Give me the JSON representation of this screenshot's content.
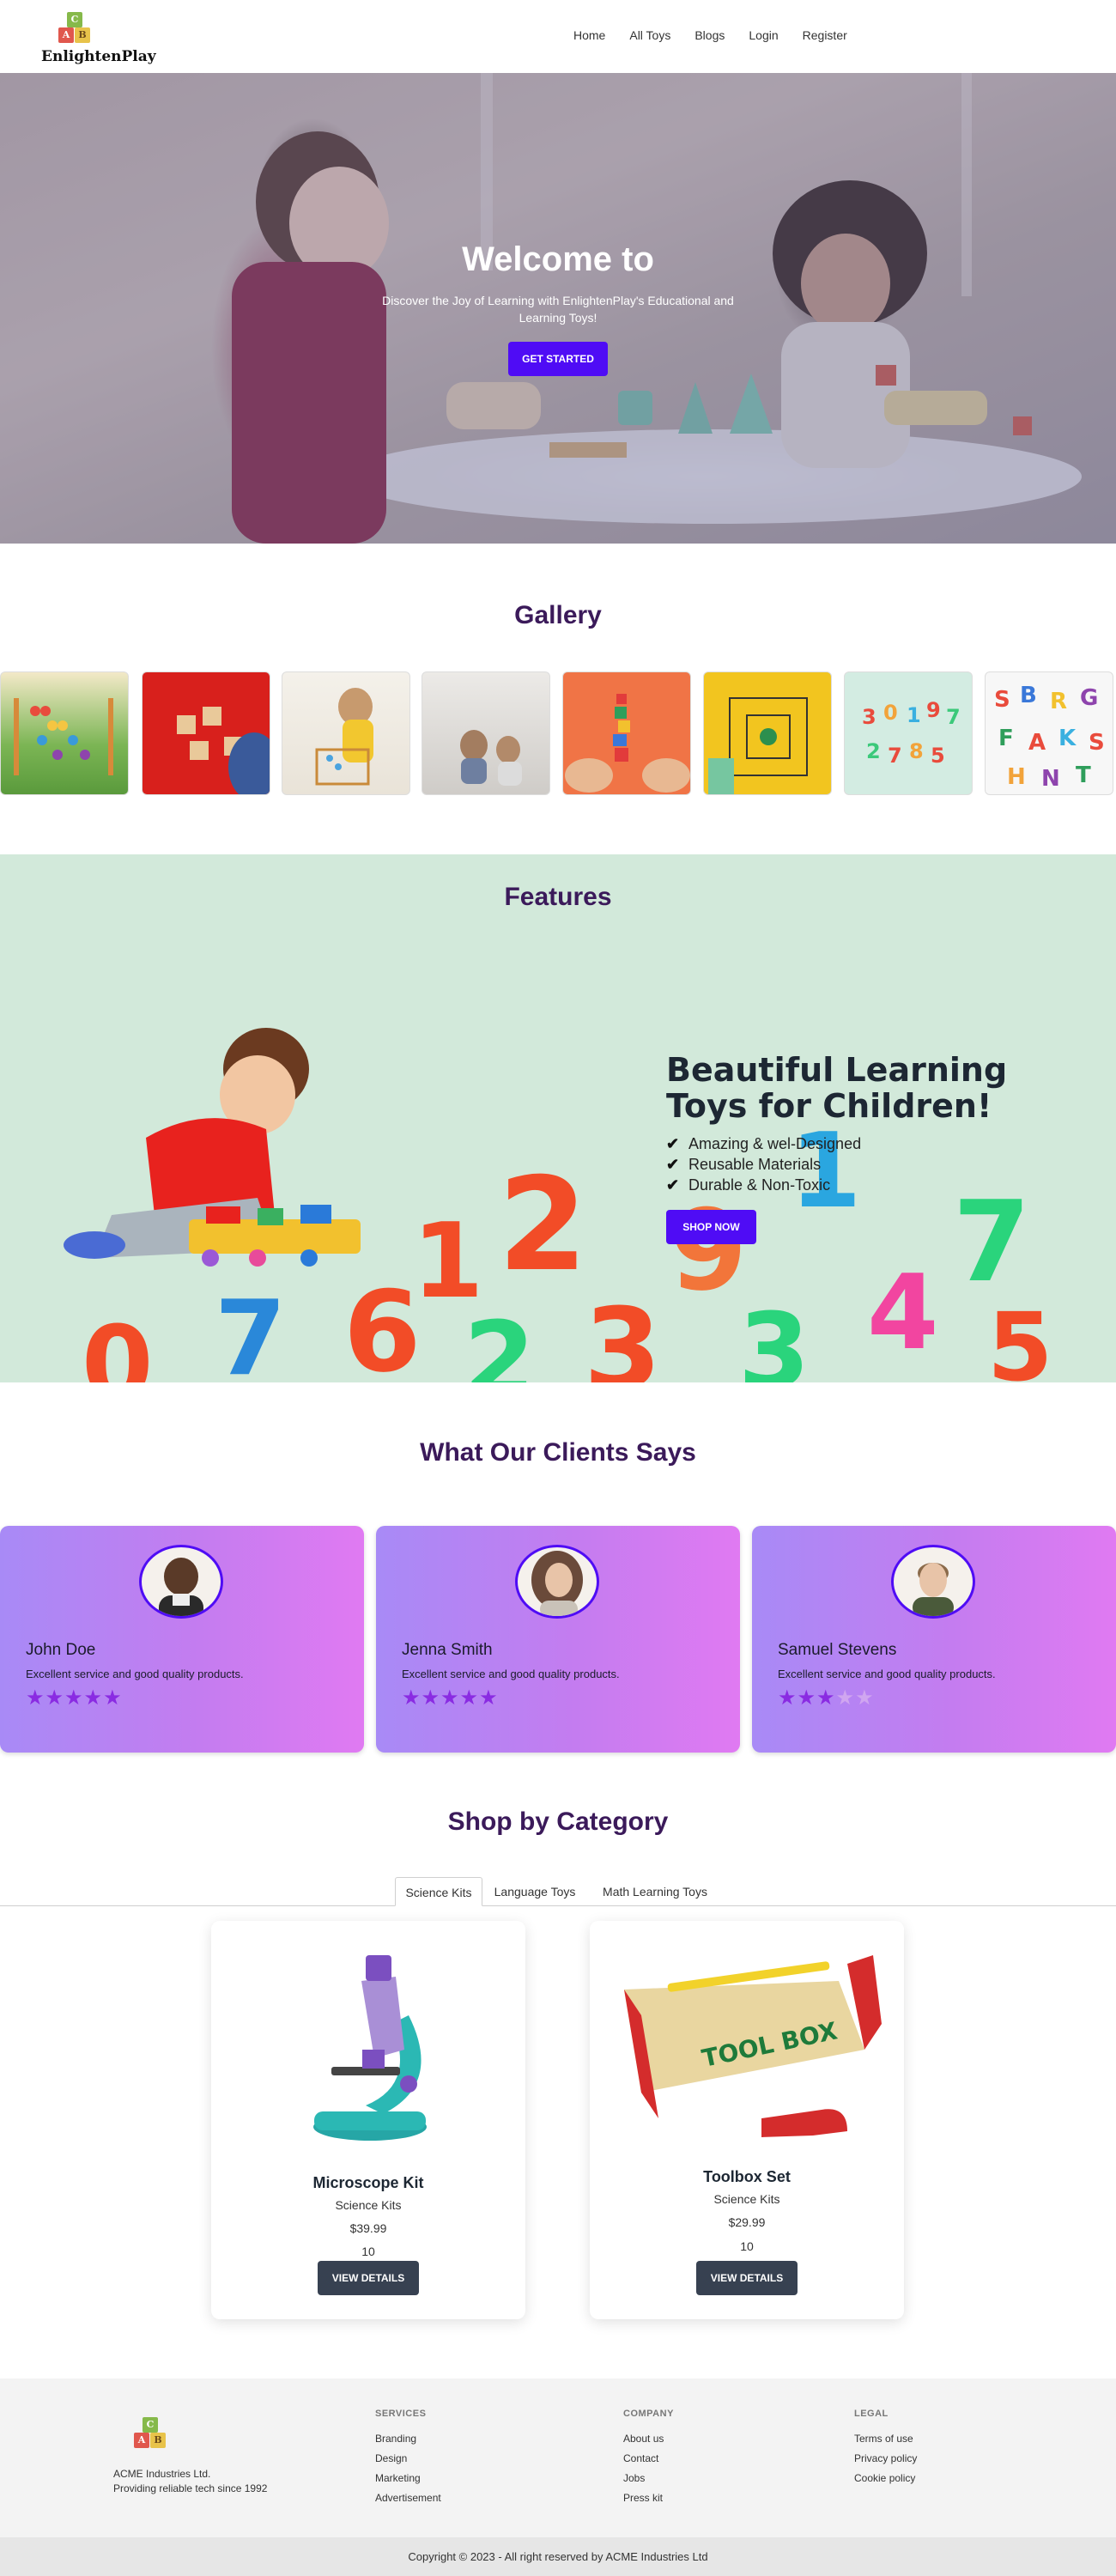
{
  "brand": {
    "name": "EnlightenPlay",
    "logo_letters": [
      "C",
      "A",
      "B"
    ]
  },
  "nav": {
    "items": [
      "Home",
      "All Toys",
      "Blogs",
      "Login",
      "Register"
    ]
  },
  "hero": {
    "title": "Welcome to",
    "subtitle": "Discover the Joy of Learning with EnlightenPlay's Educational and Learning Toys!",
    "button": "GET STARTED"
  },
  "gallery": {
    "title": "Gallery"
  },
  "features": {
    "title": "Features",
    "heading": "Beautiful Learning Toys for Children!",
    "items": [
      "Amazing & wel-Designed",
      "Reusable Materials",
      "Durable & Non-Toxic"
    ],
    "button": "SHOP NOW",
    "numbers": [
      "1",
      "2",
      "9",
      "1",
      "7",
      "6",
      "3",
      "4",
      "7",
      "3",
      "5",
      "0",
      "2"
    ]
  },
  "testimonials": {
    "title": "What Our Clients Says",
    "items": [
      {
        "name": "John Doe",
        "text": "Excellent service and good quality products.",
        "rating": 5
      },
      {
        "name": "Jenna Smith",
        "text": "Excellent service and good quality products.",
        "rating": 5
      },
      {
        "name": "Samuel Stevens",
        "text": "Excellent service and good quality products.",
        "rating": 3
      }
    ],
    "star_on": "★",
    "star_off": "★"
  },
  "shop": {
    "title": "Shop by Category",
    "tabs": [
      "Science Kits",
      "Language Toys",
      "Math Learning Toys"
    ],
    "active_tab": "Science Kits",
    "products": [
      {
        "name": "Microscope Kit",
        "category": "Science Kits",
        "price": "$39.99",
        "quantity": "10",
        "button": "VIEW DETAILS"
      },
      {
        "name": "Toolbox Set",
        "category": "Science Kits",
        "price": "$29.99",
        "quantity": "10",
        "button": "VIEW DETAILS",
        "image_label": "TOOL BOX"
      }
    ]
  },
  "footer": {
    "company_name": "ACME Industries Ltd.",
    "tagline": "Providing reliable tech since 1992",
    "columns": [
      {
        "title": "SERVICES",
        "links": [
          "Branding",
          "Design",
          "Marketing",
          "Advertisement"
        ]
      },
      {
        "title": "COMPANY",
        "links": [
          "About us",
          "Contact",
          "Jobs",
          "Press kit"
        ]
      },
      {
        "title": "LEGAL",
        "links": [
          "Terms of use",
          "Privacy policy",
          "Cookie policy"
        ]
      }
    ],
    "copyright": "Copyright © 2023 - All right reserved by ACME Industries Ltd"
  },
  "colors": {
    "primary": "#4f0cf5",
    "heading_purple": "#3b1a5a",
    "features_bg": "#d2e9da",
    "card_gradient_start": "#a88af6",
    "card_gradient_end": "#e07af2",
    "dark_button": "#374151"
  }
}
